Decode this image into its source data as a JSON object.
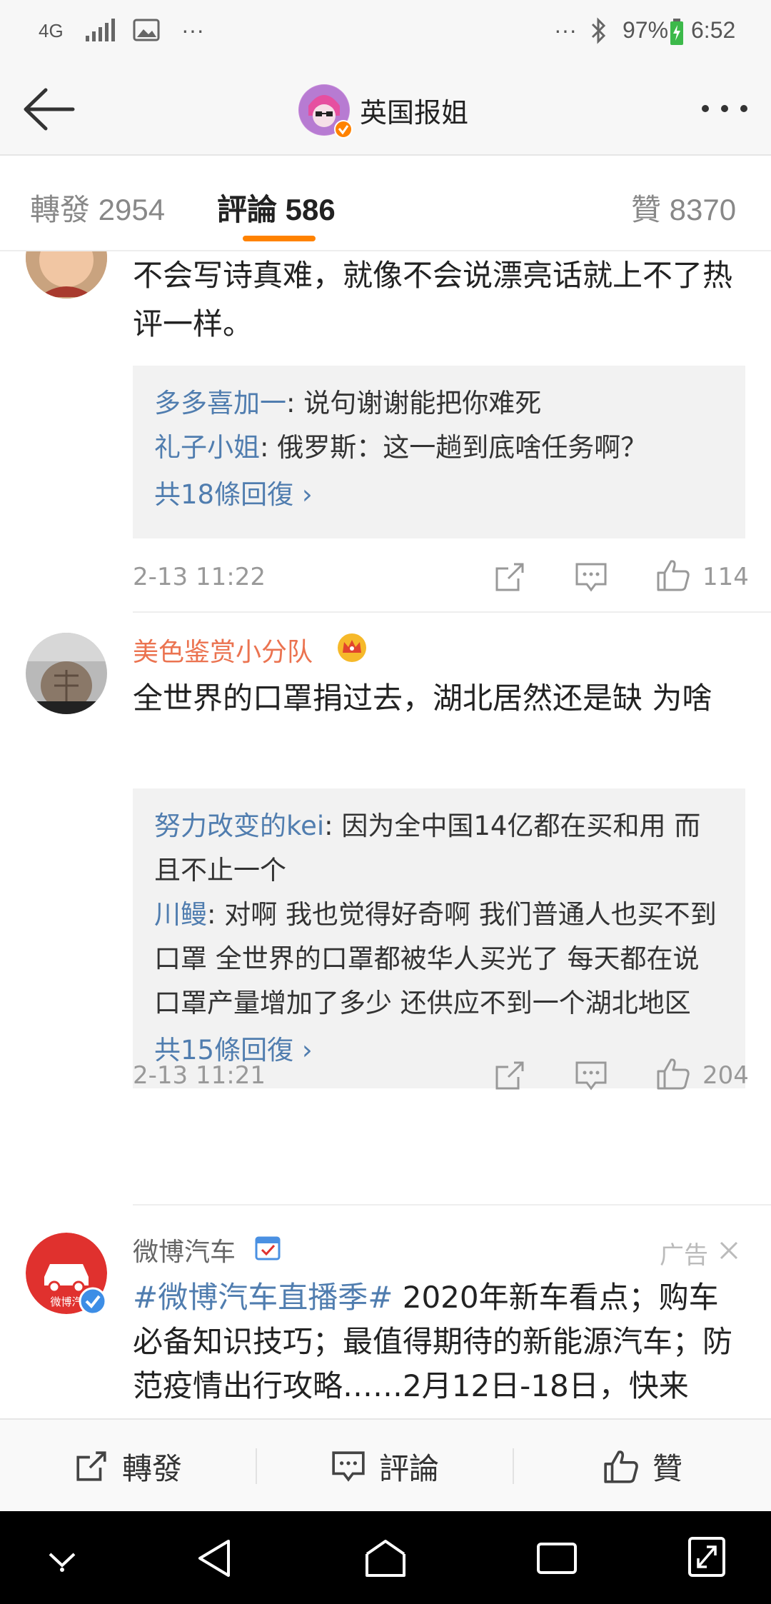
{
  "status_bar": {
    "network": "4G",
    "more_left": "···",
    "more_right": "···",
    "battery": "97%",
    "time": "6:52"
  },
  "header": {
    "title": "英国报姐"
  },
  "tabs": [
    {
      "label": "轉發 2954"
    },
    {
      "label": "評論 586"
    },
    {
      "label": "贊 8370"
    }
  ],
  "comments": [
    {
      "text": "不会写诗真难，就像不会说漂亮话就上不了热评一样。",
      "replies": [
        {
          "name": "多多喜加一",
          "text": ": 说句谢谢能把你难死"
        },
        {
          "name": "礼子小姐",
          "text": ": 俄罗斯：这一趟到底啥任务啊？"
        }
      ],
      "more_replies": "共18條回復 ›",
      "time": "2-13 11:22",
      "likes": "114"
    },
    {
      "username": "美色鉴赏小分队",
      "text": "全世界的口罩捐过去，湖北居然还是缺 为啥",
      "replies": [
        {
          "name": "努力改变的kei",
          "text": ": 因为全中国14亿都在买和用 而且不止一个"
        },
        {
          "name": "川鳗",
          "text": ": 对啊  我也觉得好奇啊  我们普通人也买不到口罩 全世界的口罩都被华人买光了 每天都在说口罩产量增加了多少 还供应不到一个湖北地区"
        }
      ],
      "more_replies": "共15條回復 ›",
      "time": "2-13 11:21",
      "likes": "204"
    }
  ],
  "ad": {
    "username": "微博汽车",
    "avatar_text": "微博汽",
    "ad_label": "广告",
    "hashtag": "#微博汽车直播季#",
    "text": " 2020年新车看点；购车必备知识技巧；最值得期待的新能源汽车；防范疫情出行攻略……2月12日-18日，快来"
  },
  "action_bar": {
    "repost": "轉發",
    "comment": "評論",
    "like": "贊"
  },
  "colors": {
    "accent": "#ff8200",
    "link": "#507daf",
    "username": "#eb7350"
  }
}
